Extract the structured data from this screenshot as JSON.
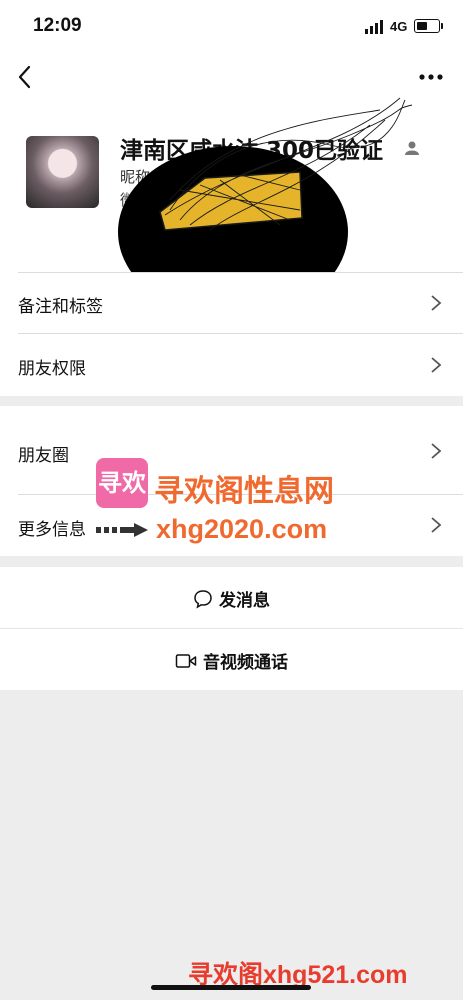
{
  "status": {
    "time": "12:09",
    "network": "4G",
    "battery_level": 0.55
  },
  "profile": {
    "name": "津南区咸水沽 300已验证",
    "nickname_prefix": "昵称",
    "wxid_prefix": "微"
  },
  "rows": [
    {
      "label": "备注和标签"
    },
    {
      "label": "朋友权限"
    },
    {
      "label": "朋友圈"
    },
    {
      "label": "更多信息"
    }
  ],
  "actions": {
    "message": "发消息",
    "call": "音视频通话"
  },
  "watermark": {
    "logo": "寻欢",
    "title": "寻欢阁性息网",
    "url": "xhg2020.com",
    "bottom": "寻欢阁xhg521.com"
  }
}
